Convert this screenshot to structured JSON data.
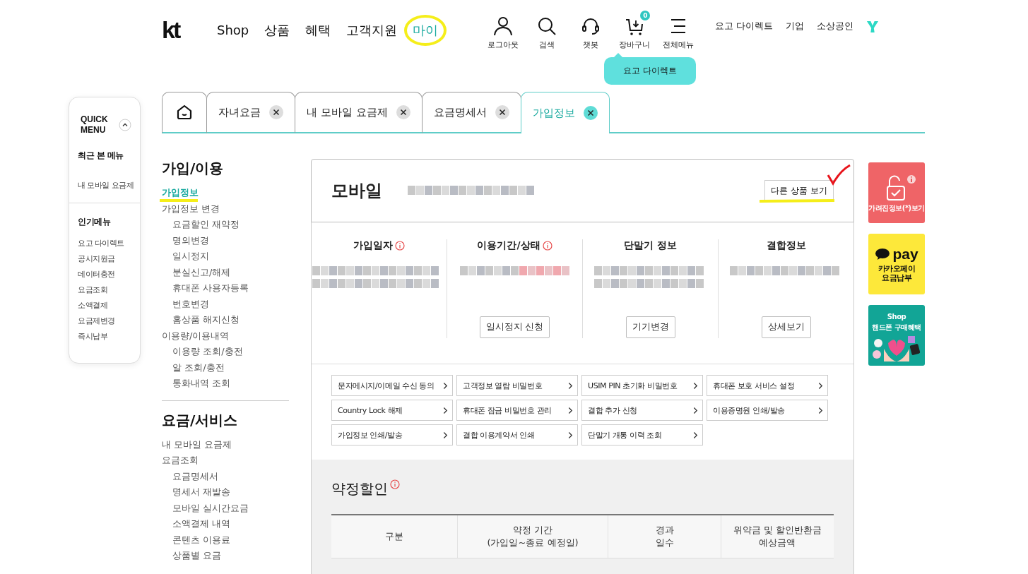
{
  "header": {
    "logo": "kt",
    "nav": [
      {
        "label": "Shop",
        "selected": false
      },
      {
        "label": "상품",
        "selected": false
      },
      {
        "label": "혜택",
        "selected": false
      },
      {
        "label": "고객지원",
        "selected": false
      },
      {
        "label": "마이",
        "selected": true
      }
    ],
    "icons": [
      {
        "kind": "person",
        "label": "로그아웃"
      },
      {
        "kind": "search",
        "label": "검색"
      },
      {
        "kind": "headset",
        "label": "챗봇"
      },
      {
        "kind": "cart",
        "label": "장바구니",
        "badge": "0"
      },
      {
        "kind": "menu",
        "label": "전체메뉴"
      }
    ],
    "links": [
      "요고 다이렉트",
      "기업",
      "소상공인"
    ],
    "tooltip": "요고 다이렉트"
  },
  "tabs": [
    {
      "kind": "home",
      "selected": false
    },
    {
      "kind": "page",
      "label": "자녀요금",
      "selected": false
    },
    {
      "kind": "page",
      "label": "내 모바일 요금제",
      "selected": false
    },
    {
      "kind": "page",
      "label": "요금명세서",
      "selected": false
    },
    {
      "kind": "page",
      "label": "가입정보",
      "selected": true
    }
  ],
  "quick_menu": {
    "title": "QUICK MENU",
    "recent_title": "최근 본 메뉴",
    "recent": [
      "내 모바일 요금제"
    ],
    "popular_title": "인기메뉴",
    "popular": [
      "요고 다이렉트",
      "공시지원금",
      "데이터충전",
      "요금조회",
      "소액결제",
      "요금제변경",
      "즉시납부"
    ]
  },
  "sidebar": {
    "sections": [
      {
        "title": "가입/이용",
        "items": [
          {
            "label": "가입정보",
            "selected": true
          },
          {
            "label": "가입정보 변경",
            "selected": false,
            "children": [
              {
                "label": "요금할인 재약정",
                "selected": false
              },
              {
                "label": "명의변경",
                "selected": false
              },
              {
                "label": "일시정지",
                "selected": false
              },
              {
                "label": "분실신고/해제",
                "selected": false
              },
              {
                "label": "휴대폰 사용자등록",
                "selected": false
              },
              {
                "label": "번호변경",
                "selected": false
              },
              {
                "label": "홈상품 해지신청",
                "selected": false
              }
            ]
          },
          {
            "label": "이용량/이용내역",
            "selected": false,
            "children": [
              {
                "label": "이용량 조회/충전",
                "selected": false
              },
              {
                "label": "알 조회/충전",
                "selected": false
              },
              {
                "label": "통화내역 조회",
                "selected": false
              }
            ]
          }
        ]
      },
      {
        "title": "요금/서비스",
        "items": [
          {
            "label": "내 모바일 요금제",
            "selected": false
          },
          {
            "label": "요금조회",
            "selected": false,
            "children": [
              {
                "label": "요금명세서",
                "selected": false
              },
              {
                "label": "명세서 재발송",
                "selected": false
              },
              {
                "label": "모바일 실시간요금",
                "selected": false
              },
              {
                "label": "소액결제 내역",
                "selected": false
              },
              {
                "label": "콘텐츠 이용료",
                "selected": false
              },
              {
                "label": "상품별 요금",
                "selected": false
              }
            ]
          }
        ]
      }
    ]
  },
  "product": {
    "title": "모바일",
    "button": "다른 상품 보기"
  },
  "info_columns": [
    {
      "title": "가입일자",
      "info": true
    },
    {
      "title": "이용기간/상태",
      "info": true,
      "button": "일시정지 신청"
    },
    {
      "title": "단말기 정보",
      "info": false,
      "button": "기기변경"
    },
    {
      "title": "결합정보",
      "info": false,
      "button": "상세보기"
    }
  ],
  "quick_links": [
    "문자메시지/이메일 수신 동의",
    "고객정보 열람 비밀번호",
    "USIM PIN 초기화 비밀번호",
    "휴대폰 보호 서비스 설정",
    "Country Lock 해제",
    "휴대폰 잠금 비밀번호 관리",
    "결합 추가 신청",
    "이용증명원 인쇄/발송",
    "가입정보 인쇄/발송",
    "결합 이용계약서 인쇄",
    "단말기 개통 이력 조회"
  ],
  "discount": {
    "title": "약정할인",
    "info": true,
    "columns": [
      "구분",
      "약정 기간\n(가입일~종료 예정일)",
      "경과\n일수",
      "위약금 및 할인반환금\n예상금액"
    ]
  },
  "banners": [
    {
      "kind": "privacy",
      "label": "가려진정보(*)보기"
    },
    {
      "kind": "kakaopay",
      "logo": "pay",
      "label": "카카오페이\n요금납부"
    },
    {
      "kind": "shop",
      "title": "Shop",
      "label": "핸드폰 구매혜택"
    }
  ]
}
